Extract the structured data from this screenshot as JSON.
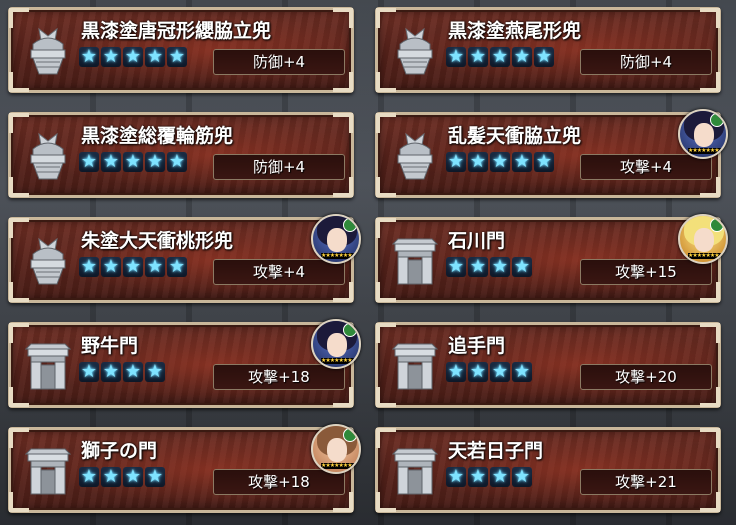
{
  "items": [
    {
      "name": "黒漆塗唐冠形纓脇立兜",
      "stars": "★★★★★",
      "stat": "防御+4",
      "icon": "kabuto-helmet-icon"
    },
    {
      "name": "黒漆塗燕尾形兜",
      "stars": "★★★★★",
      "stat": "防御+4",
      "icon": "kabuto-helmet-icon"
    },
    {
      "name": "黒漆塗総覆輪筋兜",
      "stars": "★★★★★",
      "stat": "防御+4",
      "icon": "kabuto-helmet-icon"
    },
    {
      "name": "乱髪天衝脇立兜",
      "stars": "★★★★★",
      "stat": "攻撃+4",
      "icon": "kabuto-helmet-icon",
      "portrait": "purple"
    },
    {
      "name": "朱塗大天衝桃形兜",
      "stars": "★★★★★",
      "stat": "攻撃+4",
      "icon": "kabuto-helmet-icon",
      "portrait": "purple"
    },
    {
      "name": "石川門",
      "stars": "★★★★",
      "stat": "攻撃+15",
      "icon": "castle-gate-icon",
      "portrait": "gold"
    },
    {
      "name": "野牛門",
      "stars": "★★★★",
      "stat": "攻撃+18",
      "icon": "castle-gate-icon",
      "portrait": "purple"
    },
    {
      "name": "追手門",
      "stars": "★★★★",
      "stat": "攻撃+20",
      "icon": "castle-gate-icon"
    },
    {
      "name": "獅子の門",
      "stars": "★★★★",
      "stat": "攻撃+18",
      "icon": "castle-gate-icon",
      "portrait": "pink"
    },
    {
      "name": "天若日子門",
      "stars": "★★★★",
      "stat": "攻撃+21",
      "icon": "castle-gate-icon"
    }
  ],
  "colors": {
    "frame": "#c9b79a",
    "panel": "#5a241c",
    "star": "#7fe3ff"
  }
}
